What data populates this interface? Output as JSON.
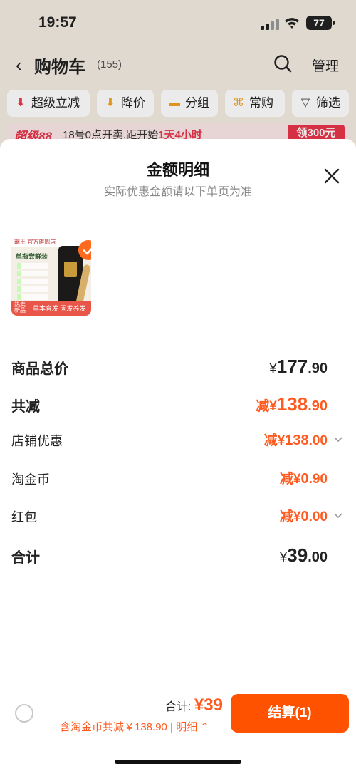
{
  "status_bar": {
    "time": "19:57",
    "battery": "77"
  },
  "cart": {
    "title": "购物车",
    "count": "(155)",
    "manage": "管理",
    "chips": [
      {
        "label": "超级立减",
        "icon": "arrow-down-red-icon"
      },
      {
        "label": "降价",
        "icon": "price-drop-icon"
      },
      {
        "label": "分组",
        "icon": "folder-icon"
      },
      {
        "label": "常购",
        "icon": "cart-icon"
      },
      {
        "label": "筛选",
        "icon": "filter-icon"
      }
    ],
    "promo": {
      "tag": "超级88",
      "text_prefix": "18号0点开卖,距开始",
      "countdown": "1天4小时",
      "button": "领300元"
    }
  },
  "sheet": {
    "title": "金额明细",
    "subtitle": "实际优惠金额请以下单页为准",
    "product": {
      "brand": "霸王 官方旗舰店",
      "heading": "单瓶尝鲜装",
      "hot_tag": "热卖新品",
      "slogan": "草本育发 固发养发"
    },
    "rows": [
      {
        "label": "商品总价",
        "prefix": "¥",
        "int": "177",
        "dec": ".90"
      },
      {
        "label": "共减",
        "prefix": "减¥",
        "int": "138",
        "dec": ".90"
      },
      {
        "label": "店铺优惠",
        "prefix": "减¥",
        "int": "138",
        "dec": ".00"
      },
      {
        "label": "淘金币",
        "prefix": "减¥",
        "int": "0",
        "dec": ".90"
      },
      {
        "label": "红包",
        "prefix": "减¥",
        "int": "0",
        "dec": ".00"
      },
      {
        "label": "合计",
        "prefix": "¥",
        "int": "39",
        "dec": ".00"
      }
    ]
  },
  "bottom": {
    "total_label": "合计: ",
    "total_amount": "¥39",
    "savings": "含淘金币共减￥138.90 | 明细",
    "checkout": "结算(1)"
  },
  "colors": {
    "accent": "#ff5200",
    "promo_red": "#e8354a"
  }
}
